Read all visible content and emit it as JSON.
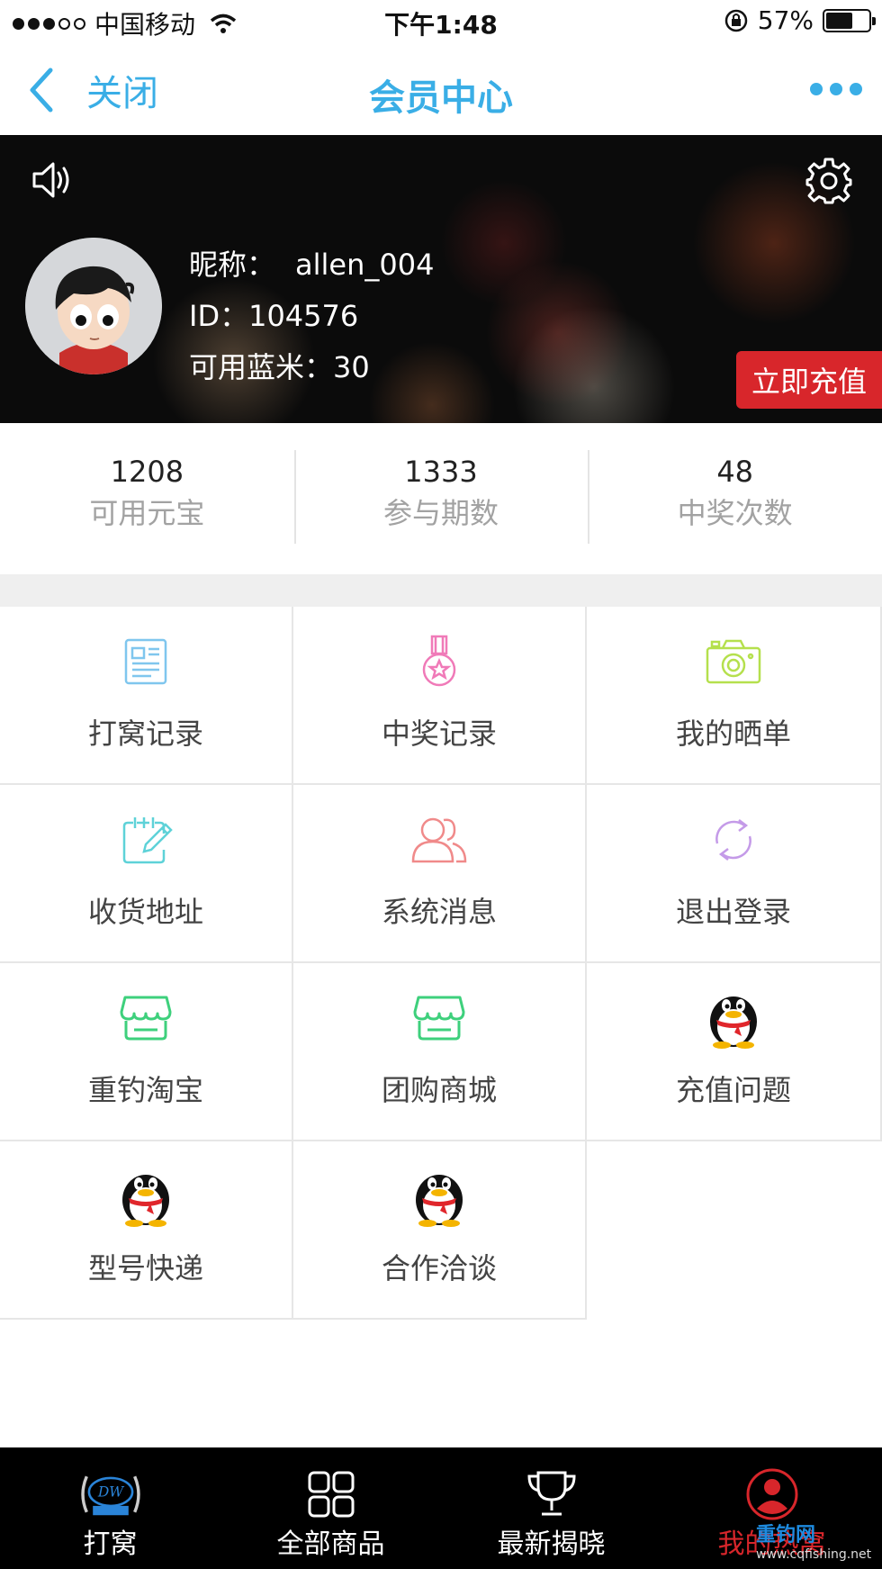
{
  "status_bar": {
    "carrier": "中国移动",
    "time": "下午1:48",
    "battery": "57%"
  },
  "nav": {
    "back_label": "关闭",
    "title": "会员中心"
  },
  "profile": {
    "nickname_label": "昵称：",
    "nickname": "allen_004",
    "id_text": "ID：104576",
    "blue_rice_text": "可用蓝米：30",
    "recharge_label": "立即充值"
  },
  "stats": [
    {
      "value": "1208",
      "label": "可用元宝"
    },
    {
      "value": "1333",
      "label": "参与期数"
    },
    {
      "value": "48",
      "label": "中奖次数"
    }
  ],
  "menu": [
    {
      "label": "打窝记录",
      "icon": "document-icon"
    },
    {
      "label": "中奖记录",
      "icon": "medal-icon"
    },
    {
      "label": "我的晒单",
      "icon": "camera-icon"
    },
    {
      "label": "收货地址",
      "icon": "edit-calendar-icon"
    },
    {
      "label": "系统消息",
      "icon": "users-icon"
    },
    {
      "label": "退出登录",
      "icon": "refresh-icon"
    },
    {
      "label": "重钓淘宝",
      "icon": "store-icon"
    },
    {
      "label": "团购商城",
      "icon": "store-icon"
    },
    {
      "label": "充值问题",
      "icon": "qq-penguin-icon"
    },
    {
      "label": "型号快递",
      "icon": "qq-penguin-icon"
    },
    {
      "label": "合作洽谈",
      "icon": "qq-penguin-icon"
    }
  ],
  "tabs": [
    {
      "label": "打窝",
      "icon": "logo-icon"
    },
    {
      "label": "全部商品",
      "icon": "grid-icon"
    },
    {
      "label": "最新揭晓",
      "icon": "trophy-icon"
    },
    {
      "label": "我的热窝",
      "icon": "user-icon"
    }
  ],
  "watermark": {
    "title": "重钓网",
    "url": "www.cqfishing.net"
  },
  "colors": {
    "accent": "#3aaee6",
    "recharge": "#d8262b",
    "active_tab": "#d8262b"
  }
}
